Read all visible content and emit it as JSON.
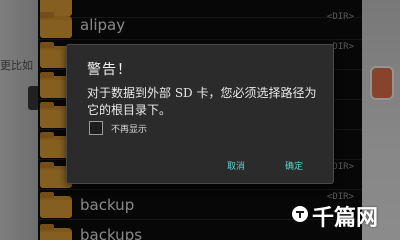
{
  "background": {
    "left_partial_text": "更比如",
    "right_badge_color": "#e9744a"
  },
  "file_list": {
    "dir_tag": "<DIR>",
    "rows": [
      {
        "name": ""
      },
      {
        "name": "alipay"
      },
      {
        "name": ""
      },
      {
        "name": ""
      },
      {
        "name": ""
      },
      {
        "name": ""
      },
      {
        "name": "backup"
      },
      {
        "name": "backups"
      }
    ]
  },
  "dialog": {
    "title": "警告！",
    "message": "对于数据到外部 SD 卡，您必须选择路径为它的根目录下。",
    "checkbox_label": "不再显示",
    "checkbox_checked": false,
    "cancel_label": "取消",
    "ok_label": "确定",
    "button_color": "#5fd0c8"
  },
  "watermark": {
    "text": "千篇网",
    "icon": "watermark-logo-icon"
  }
}
